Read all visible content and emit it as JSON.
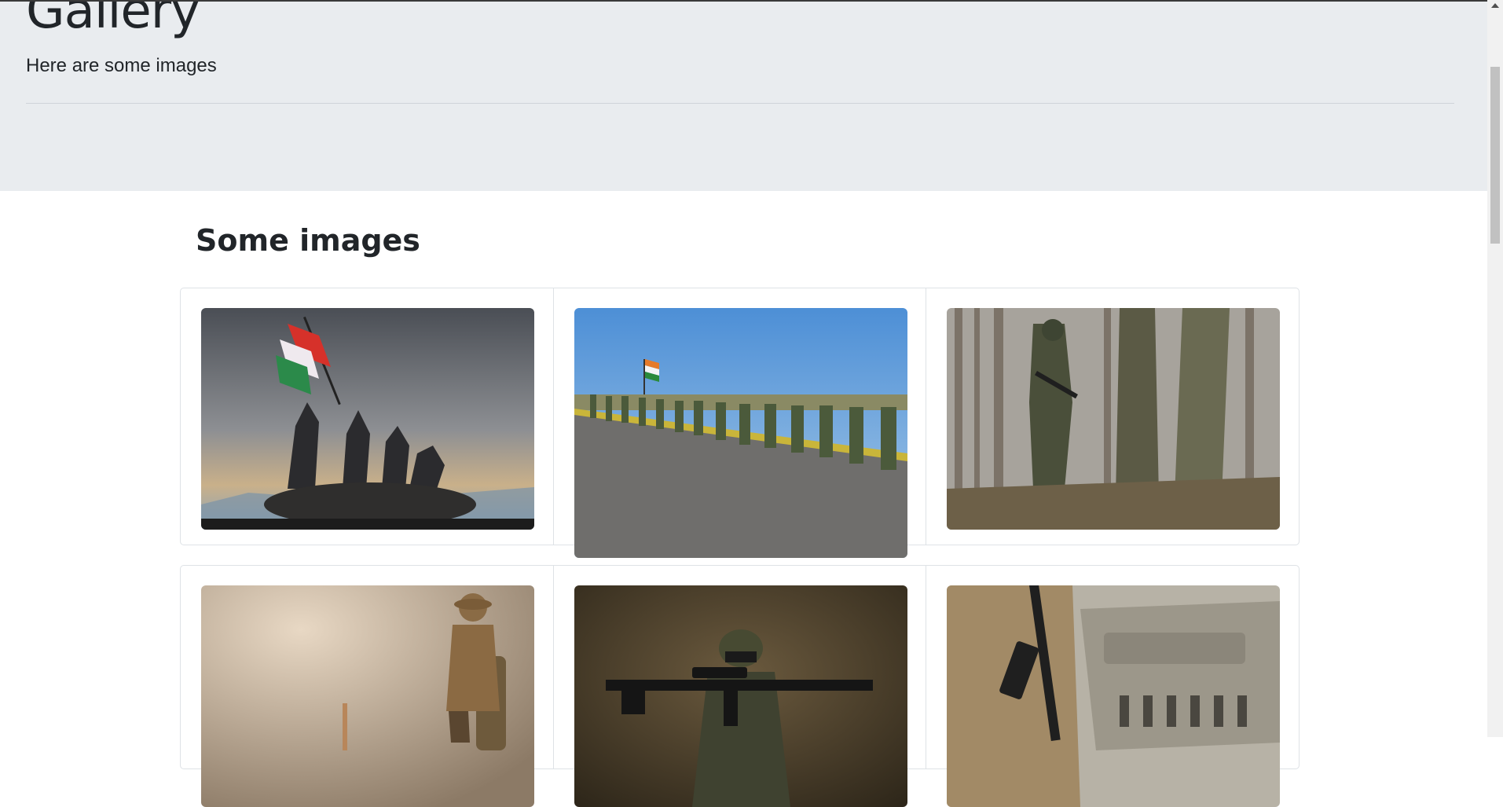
{
  "header": {
    "title": "Gallery",
    "lead": "Here are some images"
  },
  "section": {
    "title": "Some images"
  },
  "gallery": {
    "row1": [
      {
        "alt": "soldiers raising flag statue"
      },
      {
        "alt": "soldiers lined up on road with flag"
      },
      {
        "alt": "soldier in forest"
      }
    ],
    "row2": [
      {
        "alt": "toy soldier walking"
      },
      {
        "alt": "soldier with rifle"
      },
      {
        "alt": "soldier with rifle near tank"
      }
    ]
  },
  "colors": {
    "jumbotron": "#e9ecef",
    "border": "#dee2e6",
    "text": "#212529"
  }
}
